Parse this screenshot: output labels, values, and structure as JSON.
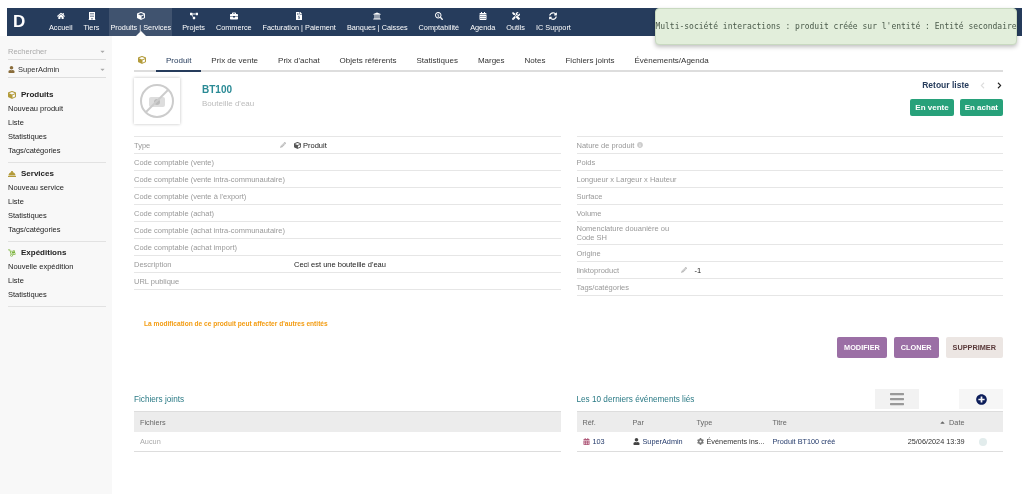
{
  "navbar": {
    "logo": "D",
    "items": [
      {
        "label": "Accueil",
        "selected": false
      },
      {
        "label": "Tiers",
        "selected": false
      },
      {
        "label": "Produits | Services",
        "selected": true
      },
      {
        "label": "Projets",
        "selected": false
      },
      {
        "label": "Commerce",
        "selected": false
      },
      {
        "label": "Facturation | Paiement",
        "selected": false
      },
      {
        "label": "Banques | Caisses",
        "selected": false
      },
      {
        "label": "Comptabilité",
        "selected": false
      },
      {
        "label": "Agenda",
        "selected": false
      },
      {
        "label": "Outils",
        "selected": false
      },
      {
        "label": "IC Support",
        "selected": false
      }
    ]
  },
  "toast": {
    "message": "Multi-société interactions : produit créée sur l'entité : Entité secondaire"
  },
  "sidebar": {
    "search": {
      "placeholder": "Rechercher"
    },
    "user": "SuperAdmin",
    "sections": [
      {
        "title": "Produits",
        "items": [
          "Nouveau produit",
          "Liste",
          "Statistiques",
          "Tags/catégories"
        ]
      },
      {
        "title": "Services",
        "items": [
          "Nouveau service",
          "Liste",
          "Statistiques",
          "Tags/catégories"
        ]
      },
      {
        "title": "Expéditions",
        "items": [
          "Nouvelle expédition",
          "Liste",
          "Statistiques"
        ]
      }
    ]
  },
  "tabs": [
    {
      "label": "Produit",
      "selected": true
    },
    {
      "label": "Prix de vente",
      "selected": false
    },
    {
      "label": "Prix d'achat",
      "selected": false
    },
    {
      "label": "Objets référents",
      "selected": false
    },
    {
      "label": "Statistiques",
      "selected": false
    },
    {
      "label": "Marges",
      "selected": false
    },
    {
      "label": "Notes",
      "selected": false
    },
    {
      "label": "Fichiers joints",
      "selected": false
    },
    {
      "label": "Évènements/Agenda",
      "selected": false
    }
  ],
  "product": {
    "ref": "BT100",
    "label": "Bouteille d'eau",
    "back_link": "Retour liste",
    "previous_enabled": false,
    "next_enabled": true,
    "status_badges": [
      "En vente",
      "En achat"
    ]
  },
  "left_fields": [
    {
      "label": "Type",
      "value": "Produit",
      "kind": "type",
      "editable": true
    },
    {
      "label": "Code comptable (vente)",
      "kind": "plain",
      "editable": false
    },
    {
      "label": "Code comptable (vente intra-communautaire)",
      "kind": "plain",
      "editable": false
    },
    {
      "label": "Code comptable (vente à l'export)",
      "kind": "plain",
      "editable": false
    },
    {
      "label": "Code comptable (achat)",
      "kind": "plain",
      "editable": false
    },
    {
      "label": "Code comptable (achat intra-communautaire)",
      "kind": "plain",
      "editable": false
    },
    {
      "label": "Code comptable (achat import)",
      "kind": "plain",
      "editable": false
    },
    {
      "label": "Description",
      "value": "Ceci est une bouteille d'eau",
      "kind": "plain",
      "editable": false
    },
    {
      "label": "URL publique",
      "kind": "plain",
      "editable": false
    }
  ],
  "right_fields": [
    {
      "label": "Nature de produit",
      "kind": "info",
      "editable": false
    },
    {
      "label": "Poids",
      "kind": "plain",
      "editable": false
    },
    {
      "label": "Longueur x Largeur x Hauteur",
      "kind": "plain",
      "editable": false
    },
    {
      "label": "Surface",
      "kind": "plain",
      "editable": false
    },
    {
      "label": "Volume",
      "kind": "plain",
      "editable": false
    },
    {
      "label": "Nomenclature douanière ou Code SH",
      "kind": "plain",
      "editable": false
    },
    {
      "label": "Origine",
      "kind": "plain",
      "editable": false
    },
    {
      "label": "linktoproduct",
      "value": "-1",
      "kind": "plain",
      "editable": true
    },
    {
      "label": "Tags/catégories",
      "kind": "plain",
      "editable": false
    }
  ],
  "warning": "La modification de ce produit peut affecter d'autres entités",
  "actions": [
    {
      "label": "MODIFIER",
      "kind": "primary"
    },
    {
      "label": "CLONER",
      "kind": "primary"
    },
    {
      "label": "SUPPRIMER",
      "kind": "danger"
    }
  ],
  "files": {
    "title": "Fichiers joints",
    "column": "Fichiers",
    "empty": "Aucun"
  },
  "events": {
    "title": "Les 10 derniers événements liés",
    "columns": [
      {
        "label": "Réf.",
        "sorted": false
      },
      {
        "label": "Par",
        "sorted": false
      },
      {
        "label": "Type",
        "sorted": false
      },
      {
        "label": "Titre",
        "sorted": false
      },
      {
        "label": "Date",
        "sorted": true
      }
    ],
    "rows": [
      {
        "ref": "103",
        "by": "SuperAdmin",
        "type": "Événements ins...",
        "title": "Produit BT100 créé",
        "date": "25/06/2024 13:39"
      }
    ]
  }
}
